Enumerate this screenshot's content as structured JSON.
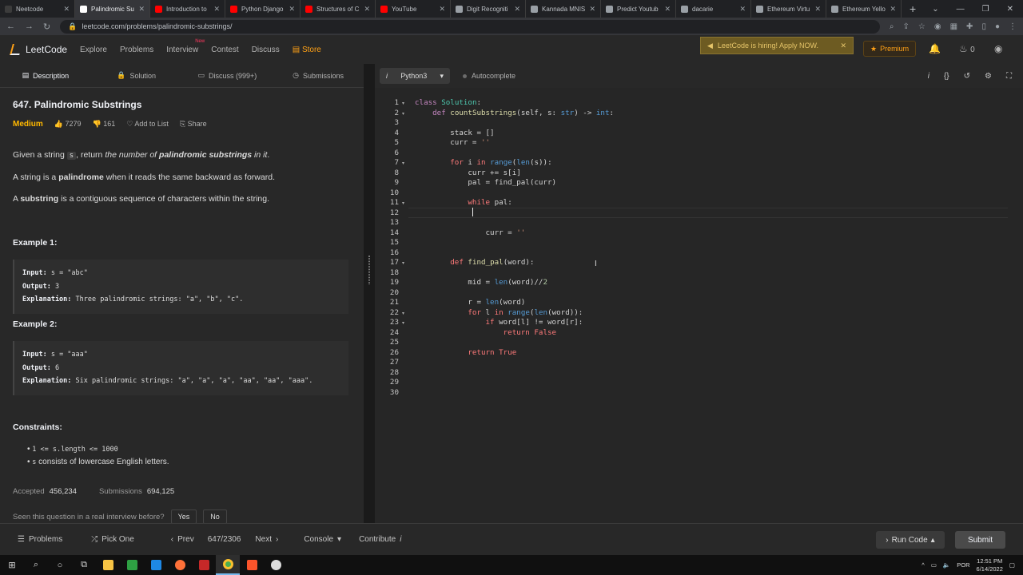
{
  "browser": {
    "tabs": [
      {
        "title": "Neetcode",
        "color": "#3c3c3c",
        "active": false
      },
      {
        "title": "Palindromic Su",
        "color": "#ffffff",
        "active": true
      },
      {
        "title": "Introduction to",
        "color": "#ff0000",
        "active": false
      },
      {
        "title": "Python Django",
        "color": "#ff0000",
        "active": false
      },
      {
        "title": "Structures of C",
        "color": "#ff0000",
        "active": false
      },
      {
        "title": "YouTube",
        "color": "#ff0000",
        "active": false
      },
      {
        "title": "Digit Recogniti",
        "color": "#9aa0a6",
        "active": false
      },
      {
        "title": "Kannada MNIS",
        "color": "#9aa0a6",
        "active": false
      },
      {
        "title": "Predict Youtub",
        "color": "#9aa0a6",
        "active": false
      },
      {
        "title": "dacarie",
        "color": "#9aa0a6",
        "active": false
      },
      {
        "title": "Ethereum Virtu",
        "color": "#9aa0a6",
        "active": false
      },
      {
        "title": "Ethereum Yello",
        "color": "#9aa0a6",
        "active": false
      }
    ],
    "url": "leetcode.com/problems/palindromic-substrings/"
  },
  "lc_nav": {
    "logo": "LeetCode",
    "items": [
      "Explore",
      "Problems",
      "Interview",
      "Contest",
      "Discuss"
    ],
    "interview_badge": "New",
    "store": "Store",
    "hiring": "LeetCode is hiring! Apply NOW.",
    "premium": "Premium",
    "streak": "0"
  },
  "left_tabs": [
    "Description",
    "Solution",
    "Discuss (999+)",
    "Submissions"
  ],
  "problem": {
    "title": "647. Palindromic Substrings",
    "difficulty": "Medium",
    "likes": "7279",
    "dislikes": "161",
    "add_to_list": "Add to List",
    "share": "Share",
    "p1_a": "Given a string ",
    "p1_code": "s",
    "p1_b": ", return ",
    "p1_c": "the number of ",
    "p1_d": "palindromic substrings",
    "p1_e": " in it",
    "p1_f": ".",
    "p2_a": "A string is a ",
    "p2_b": "palindrome",
    "p2_c": " when it reads the same backward as forward.",
    "p3_a": "A ",
    "p3_b": "substring",
    "p3_c": " is a contiguous sequence of characters within the string.",
    "ex1_title": "Example 1:",
    "ex1_input_label": "Input:",
    "ex1_input": " s = \"abc\"",
    "ex1_output_label": "Output:",
    "ex1_output": " 3",
    "ex1_expl_label": "Explanation:",
    "ex1_expl": " Three palindromic strings: \"a\", \"b\", \"c\".",
    "ex2_title": "Example 2:",
    "ex2_input_label": "Input:",
    "ex2_input": " s = \"aaa\"",
    "ex2_output_label": "Output:",
    "ex2_output": " 6",
    "ex2_expl_label": "Explanation:",
    "ex2_expl": " Six palindromic strings: \"a\", \"a\", \"a\", \"aa\", \"aa\", \"aaa\".",
    "constraints_title": "Constraints:",
    "c1": "1 <= s.length <= 1000",
    "c2_code": "s",
    "c2_text": " consists of lowercase English letters.",
    "accepted_label": "Accepted",
    "accepted": "456,234",
    "submissions_label": "Submissions",
    "submissions": "694,125",
    "seen_q": "Seen this question in a real interview before?",
    "yes": "Yes",
    "no": "No"
  },
  "editor": {
    "language": "Python3",
    "autocomplete": "Autocomplete",
    "line_count": 30
  },
  "bottom": {
    "problems": "Problems",
    "pick_one": "Pick One",
    "prev": "Prev",
    "page": "647/2306",
    "next": "Next",
    "console": "Console",
    "contribute": "Contribute",
    "run_code": "Run Code",
    "submit": "Submit"
  },
  "taskbar": {
    "lang": "POR",
    "time": "12:51 PM",
    "date": "6/14/2022"
  }
}
